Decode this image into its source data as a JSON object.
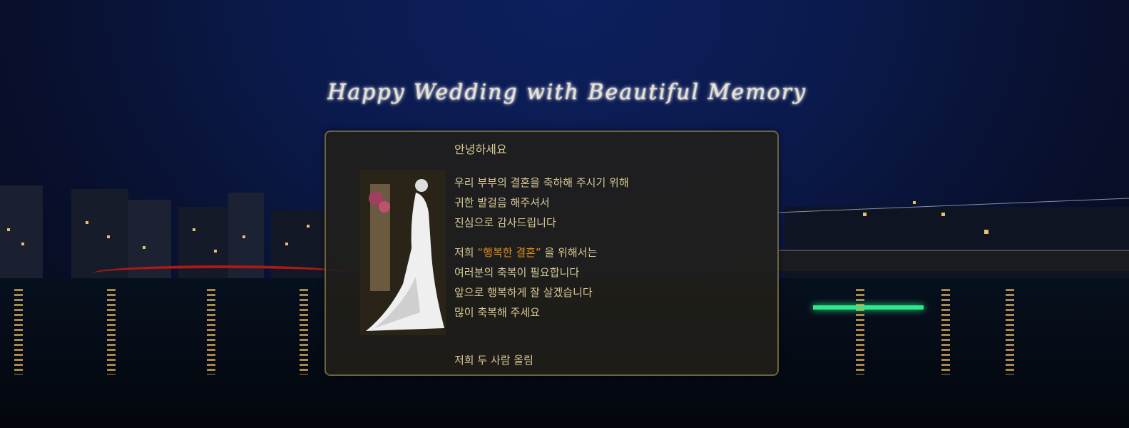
{
  "title": "Happy Wedding with Beautiful Memory",
  "greeting": "안녕하세요",
  "body_lines_a": [
    "우리 부부의 결혼을 축하해 주시기 위해",
    "귀한 발걸음 해주셔서",
    "진심으로 감사드립니다"
  ],
  "highlight_line": {
    "before": "저희",
    "highlight": "“행복한 결혼”",
    "after": "을 위해서는"
  },
  "body_lines_b": [
    "여러분의 축복이 필요합니다",
    "앞으로 행복하게 잘 살겠습니다",
    "많이 축복해 주세요"
  ],
  "closing": "저희 두 사람 올림",
  "colors": {
    "sky": "#0b1a4c",
    "panel_text": "#d8c995",
    "accent": "#e08c1c",
    "panel_border": "#6e6443"
  }
}
